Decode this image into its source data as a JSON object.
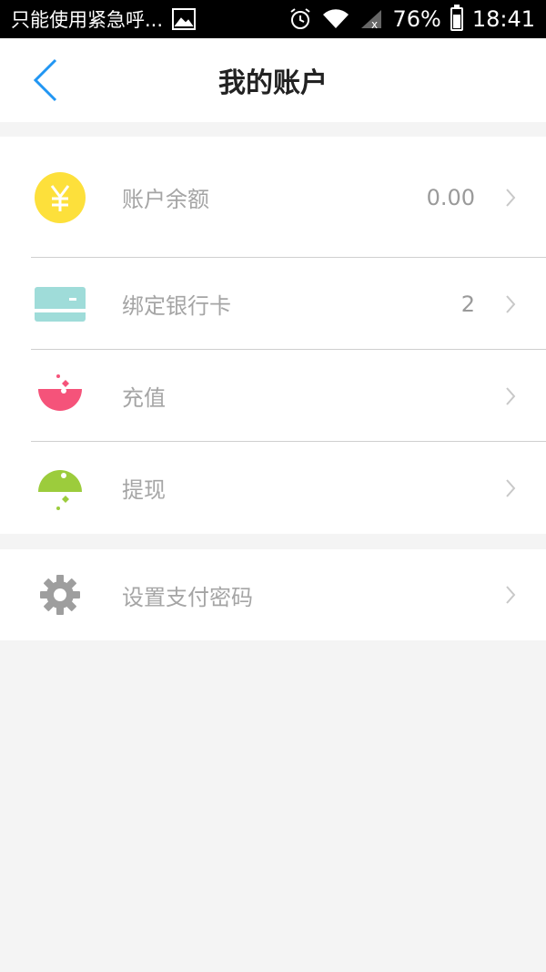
{
  "status_bar": {
    "notification_text": "只能使用紧急呼...",
    "battery_percent": "76%",
    "time": "18:41"
  },
  "header": {
    "title": "我的账户"
  },
  "account_rows": [
    {
      "label": "账户余额",
      "value": "0.00",
      "icon": "yen-coin-icon"
    },
    {
      "label": "绑定银行卡",
      "value": "2",
      "icon": "bank-card-icon"
    },
    {
      "label": "充值",
      "value": "",
      "icon": "recharge-icon"
    },
    {
      "label": "提现",
      "value": "",
      "icon": "withdraw-icon"
    }
  ],
  "settings_rows": [
    {
      "label": "设置支付密码",
      "icon": "gear-icon"
    }
  ],
  "colors": {
    "accent_blue": "#2196f3",
    "coin_yellow": "#fde03b",
    "card_teal": "#9fdcd9",
    "recharge_pink": "#f5537a",
    "withdraw_green": "#9ccc3c",
    "gear_gray": "#9e9e9e"
  }
}
